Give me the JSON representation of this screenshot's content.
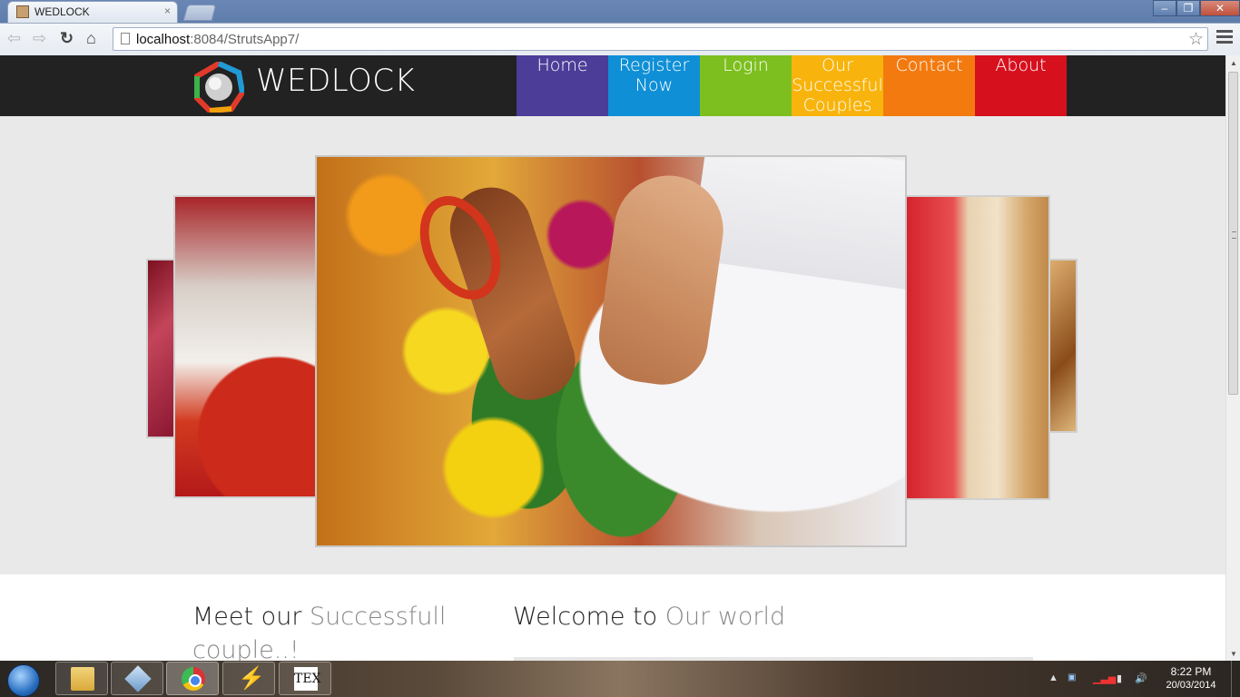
{
  "browser": {
    "tab_title": "WEDLOCK",
    "tab_close": "×",
    "url_host": "localhost",
    "url_rest": ":8084/StrutsApp7/",
    "window_min": "–",
    "window_max": "❐",
    "window_close": "✕"
  },
  "site": {
    "brand": "WEDLOCK",
    "nav": [
      {
        "label": "Home",
        "color": "#4b3d98"
      },
      {
        "label": "Register Now",
        "color": "#0f8fd6"
      },
      {
        "label": "Login",
        "color": "#7dbf1f"
      },
      {
        "label": "Our Successful Couples",
        "color": "#f8b40c"
      },
      {
        "label": "Contact",
        "color": "#f37a0f"
      },
      {
        "label": "About",
        "color": "#d7101e"
      }
    ]
  },
  "content": {
    "meet_heading_plain": "Meet our ",
    "meet_heading_accent": "Successfull couple..!",
    "welcome_heading_plain": "Welcome to ",
    "welcome_heading_accent": "Our world"
  },
  "taskbar": {
    "time": "8:22 PM",
    "date": "20/03/2014",
    "tex_label": "TEX"
  },
  "icons": {
    "back": "back-arrow-icon",
    "forward": "forward-arrow-icon",
    "reload": "reload-icon",
    "home": "home-icon",
    "bookmark": "star-icon",
    "menu": "hamburger-menu-icon"
  }
}
